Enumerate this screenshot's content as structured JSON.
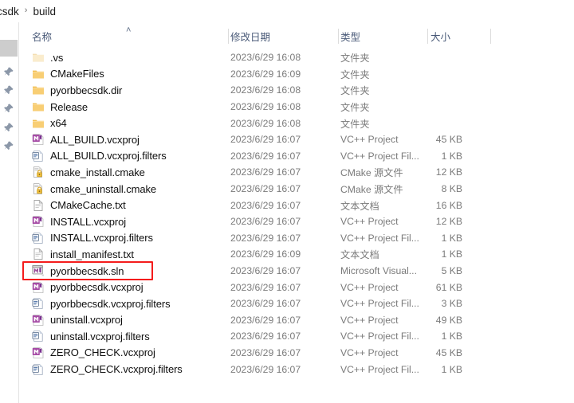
{
  "window": {
    "title": "build"
  },
  "addressbar": {
    "crumbs": [
      "csdk",
      "build"
    ],
    "separator": "›"
  },
  "navigation": {
    "items": [
      {
        "name": "pinned-item-1",
        "icon": "pin-icon"
      },
      {
        "name": "pinned-item-2",
        "icon": "pin-icon"
      },
      {
        "name": "pinned-item-3",
        "icon": "pin-icon"
      },
      {
        "name": "pinned-item-4",
        "icon": "pin-icon"
      },
      {
        "name": "pinned-item-5",
        "icon": "pin-icon"
      }
    ]
  },
  "columns": {
    "name": "名称",
    "date": "修改日期",
    "type": "类型",
    "size": "大小",
    "sort_indicator": "˄",
    "sort_column": "name",
    "sort_order": "ascending"
  },
  "files": [
    {
      "name": ".vs",
      "date": "2023/6/29 16:08",
      "type": "文件夹",
      "size": "",
      "icon": "folder-hidden-icon"
    },
    {
      "name": "CMakeFiles",
      "date": "2023/6/29 16:09",
      "type": "文件夹",
      "size": "",
      "icon": "folder-icon"
    },
    {
      "name": "pyorbbecsdk.dir",
      "date": "2023/6/29 16:08",
      "type": "文件夹",
      "size": "",
      "icon": "folder-icon"
    },
    {
      "name": "Release",
      "date": "2023/6/29 16:08",
      "type": "文件夹",
      "size": "",
      "icon": "folder-icon"
    },
    {
      "name": "x64",
      "date": "2023/6/29 16:08",
      "type": "文件夹",
      "size": "",
      "icon": "folder-icon"
    },
    {
      "name": "ALL_BUILD.vcxproj",
      "date": "2023/6/29 16:07",
      "type": "VC++ Project",
      "size": "45 KB",
      "icon": "vcxproj-icon"
    },
    {
      "name": "ALL_BUILD.vcxproj.filters",
      "date": "2023/6/29 16:07",
      "type": "VC++ Project Fil...",
      "size": "1 KB",
      "icon": "filters-icon"
    },
    {
      "name": "cmake_install.cmake",
      "date": "2023/6/29 16:07",
      "type": "CMake 源文件",
      "size": "12 KB",
      "icon": "cmake-lock-icon"
    },
    {
      "name": "cmake_uninstall.cmake",
      "date": "2023/6/29 16:07",
      "type": "CMake 源文件",
      "size": "8 KB",
      "icon": "cmake-lock-icon"
    },
    {
      "name": "CMakeCache.txt",
      "date": "2023/6/29 16:07",
      "type": "文本文档",
      "size": "16 KB",
      "icon": "text-file-icon"
    },
    {
      "name": "INSTALL.vcxproj",
      "date": "2023/6/29 16:07",
      "type": "VC++ Project",
      "size": "12 KB",
      "icon": "vcxproj-icon"
    },
    {
      "name": "INSTALL.vcxproj.filters",
      "date": "2023/6/29 16:07",
      "type": "VC++ Project Fil...",
      "size": "1 KB",
      "icon": "filters-icon"
    },
    {
      "name": "install_manifest.txt",
      "date": "2023/6/29 16:09",
      "type": "文本文档",
      "size": "1 KB",
      "icon": "text-file-icon"
    },
    {
      "name": "pyorbbecsdk.sln",
      "date": "2023/6/29 16:07",
      "type": "Microsoft Visual...",
      "size": "5 KB",
      "icon": "solution-icon"
    },
    {
      "name": "pyorbbecsdk.vcxproj",
      "date": "2023/6/29 16:07",
      "type": "VC++ Project",
      "size": "61 KB",
      "icon": "vcxproj-icon"
    },
    {
      "name": "pyorbbecsdk.vcxproj.filters",
      "date": "2023/6/29 16:07",
      "type": "VC++ Project Fil...",
      "size": "3 KB",
      "icon": "filters-icon"
    },
    {
      "name": "uninstall.vcxproj",
      "date": "2023/6/29 16:07",
      "type": "VC++ Project",
      "size": "49 KB",
      "icon": "vcxproj-icon"
    },
    {
      "name": "uninstall.vcxproj.filters",
      "date": "2023/6/29 16:07",
      "type": "VC++ Project Fil...",
      "size": "1 KB",
      "icon": "filters-icon"
    },
    {
      "name": "ZERO_CHECK.vcxproj",
      "date": "2023/6/29 16:07",
      "type": "VC++ Project",
      "size": "45 KB",
      "icon": "vcxproj-icon"
    },
    {
      "name": "ZERO_CHECK.vcxproj.filters",
      "date": "2023/6/29 16:07",
      "type": "VC++ Project Fil...",
      "size": "1 KB",
      "icon": "filters-icon"
    }
  ],
  "annotation": {
    "target": "pyorbbecsdk.sln",
    "color": "#f41c1c",
    "shape": "rectangle"
  },
  "colors": {
    "folder": "#f5c870",
    "header_text": "#4a5a78",
    "secondary_text": "#7b7b7b",
    "annotation": "#f41c1c"
  }
}
